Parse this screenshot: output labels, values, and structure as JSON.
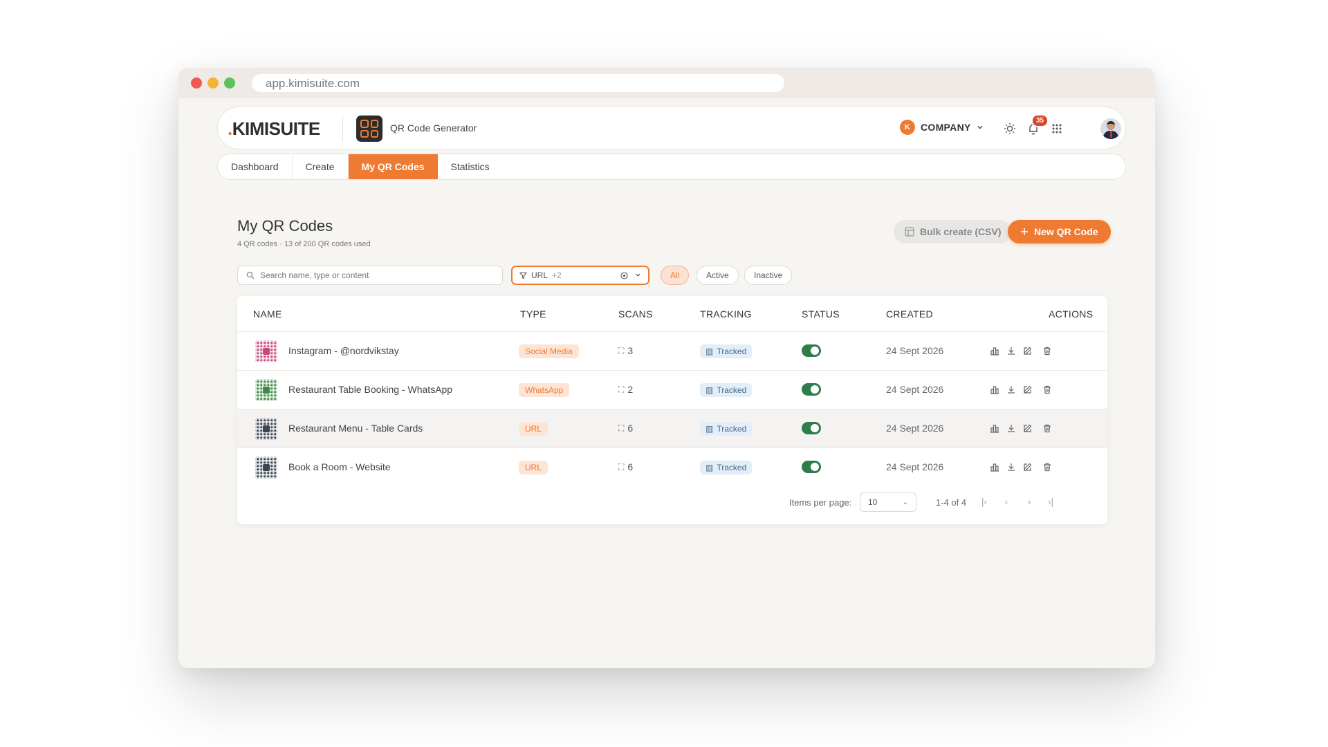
{
  "browser": {
    "url": "app.kimisuite.com"
  },
  "header": {
    "logo_dot": ".",
    "logo_text": "KIMISUITE",
    "app_name": "QR Code Generator",
    "company_initial": "K",
    "company_label": "COMPANY",
    "notification_count": "35"
  },
  "tabs": [
    {
      "label": "Dashboard"
    },
    {
      "label": "Create"
    },
    {
      "label": "My QR Codes"
    },
    {
      "label": "Statistics"
    }
  ],
  "page": {
    "title": "My QR Codes",
    "subtitle": "4 QR codes · 13 of 200 QR codes used",
    "bulk_button": "Bulk create (CSV)",
    "new_button": "New QR Code"
  },
  "filters": {
    "search_placeholder": "Search name, type or content",
    "type_filter": "URL",
    "type_filter_more": "+2",
    "chips": [
      {
        "label": "All"
      },
      {
        "label": "Active"
      },
      {
        "label": "Inactive"
      }
    ]
  },
  "table": {
    "headers": {
      "name": "NAME",
      "type": "TYPE",
      "scans": "SCANS",
      "tracking": "TRACKING",
      "status": "STATUS",
      "created": "CREATED",
      "actions": "ACTIONS"
    },
    "rows": [
      {
        "name": "Instagram - @nordvikstay",
        "type": "Social Media",
        "scans": "3",
        "tracking": "Tracked",
        "active": true,
        "created": "24 Sept 2026",
        "qr_color": "#c9487a"
      },
      {
        "name": "Restaurant Table Booking - WhatsApp",
        "type": "WhatsApp",
        "scans": "2",
        "tracking": "Tracked",
        "active": true,
        "created": "24 Sept 2026",
        "qr_color": "#3c8a44"
      },
      {
        "name": "Restaurant Menu - Table Cards",
        "type": "URL",
        "scans": "6",
        "tracking": "Tracked",
        "active": true,
        "created": "24 Sept 2026",
        "qr_color": "#3a4452"
      },
      {
        "name": "Book a Room - Website",
        "type": "URL",
        "scans": "6",
        "tracking": "Tracked",
        "active": true,
        "created": "24 Sept 2026",
        "qr_color": "#3a4452"
      }
    ]
  },
  "pagination": {
    "items_label": "Items per page:",
    "per_page": "10",
    "range": "1-4 of 4"
  },
  "colors": {
    "accent": "#ef7a31",
    "toggle_on": "#2e7d4a",
    "tracked_bg": "#e3eef8"
  },
  "icons": [
    "sun-icon",
    "bell-icon",
    "apps-grid-icon",
    "filter-icon",
    "search-icon",
    "scan-icon",
    "chart-icon",
    "download-icon",
    "edit-icon",
    "trash-icon"
  ]
}
